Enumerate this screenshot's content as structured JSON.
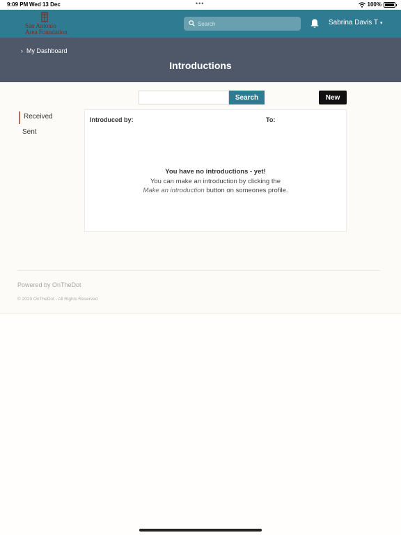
{
  "status_bar": {
    "time": "9:09 PM",
    "date": "Wed 13 Dec",
    "battery": "100%",
    "battery_level": 1.0
  },
  "top_nav": {
    "logo_line1": "San Antonio",
    "logo_line2": "Area Foundation",
    "search_placeholder": "Search",
    "user_name": "Sabrina Davis T",
    "user_caret": "▾"
  },
  "header": {
    "breadcrumb_chevron": "›",
    "breadcrumb_label": "My Dashboard",
    "page_title": "Introductions"
  },
  "toolbar": {
    "search_value": "",
    "search_button": "Search",
    "new_button": "New"
  },
  "sidebar": {
    "items": [
      {
        "label": "Received",
        "active": true
      },
      {
        "label": "Sent",
        "active": false
      }
    ]
  },
  "table": {
    "col_introduced_by": "Introduced by:",
    "col_to": "To:",
    "empty_title": "You have no introductions - yet!",
    "empty_line2": "You can make an introduction by clicking the",
    "empty_line3_em": "Make an introduction",
    "empty_line3_rest": " button on someones profile."
  },
  "footer": {
    "powered_by": "Powered by OnTheDot",
    "copyright": "© 2020 OnTheDot - All Rights Reserved"
  },
  "colors": {
    "nav_teal": "#2f7c92",
    "header_slate": "#4e5868",
    "new_button": "#111111",
    "active_indicator": "#c26a5c"
  }
}
